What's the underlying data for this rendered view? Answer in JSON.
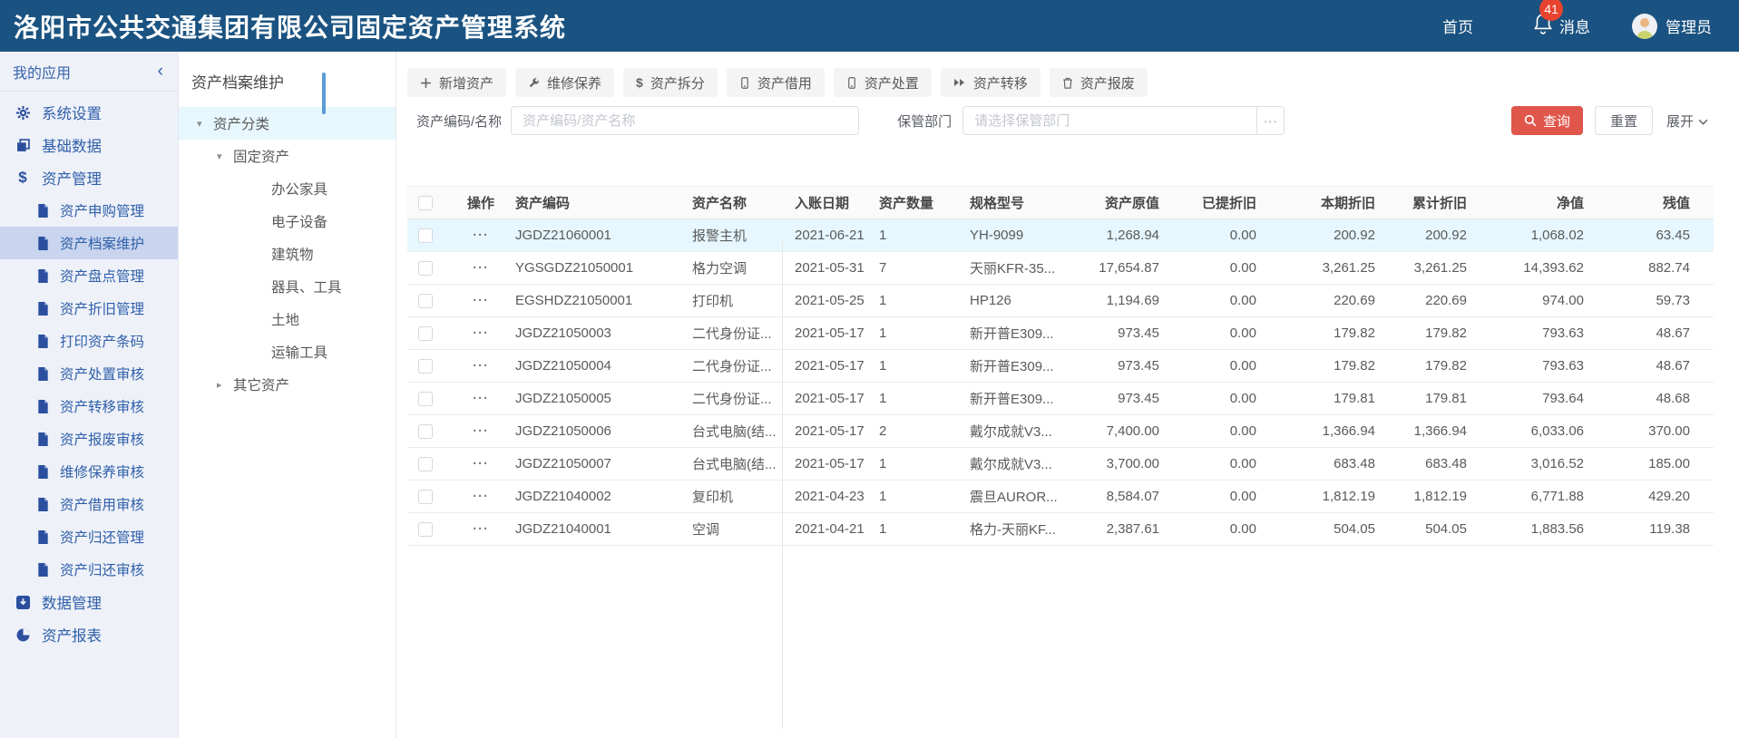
{
  "header": {
    "title": "洛阳市公共交通集团有限公司固定资产管理系统",
    "nav_home": "首页",
    "nav_messages": "消息",
    "message_count": "41",
    "user_name": "管理员"
  },
  "sidebar": {
    "title": "我的应用",
    "collapse": "‹",
    "items": [
      {
        "label": "系统设置",
        "icon": "gear",
        "level": 0
      },
      {
        "label": "基础数据",
        "icon": "copy",
        "level": 0
      },
      {
        "label": "资产管理",
        "icon": "dollar",
        "level": 0
      },
      {
        "label": "资产申购管理",
        "icon": "file",
        "level": 1
      },
      {
        "label": "资产档案维护",
        "icon": "file",
        "level": 1,
        "active": true
      },
      {
        "label": "资产盘点管理",
        "icon": "file",
        "level": 1
      },
      {
        "label": "资产折旧管理",
        "icon": "file",
        "level": 1
      },
      {
        "label": "打印资产条码",
        "icon": "file",
        "level": 1
      },
      {
        "label": "资产处置审核",
        "icon": "file",
        "level": 1
      },
      {
        "label": "资产转移审核",
        "icon": "file",
        "level": 1
      },
      {
        "label": "资产报废审核",
        "icon": "file",
        "level": 1
      },
      {
        "label": "维修保养审核",
        "icon": "file",
        "level": 1
      },
      {
        "label": "资产借用审核",
        "icon": "file",
        "level": 1
      },
      {
        "label": "资产归还管理",
        "icon": "file",
        "level": 1
      },
      {
        "label": "资产归还审核",
        "icon": "file",
        "level": 1
      },
      {
        "label": "数据管理",
        "icon": "data",
        "level": 0
      },
      {
        "label": "资产报表",
        "icon": "chart",
        "level": 0
      }
    ]
  },
  "tree": {
    "title": "资产档案维护",
    "nodes": [
      {
        "label": "资产分类",
        "level": 0,
        "caret": "down",
        "selected": true
      },
      {
        "label": "固定资产",
        "level": 1,
        "caret": "down"
      },
      {
        "label": "办公家具",
        "level": 2,
        "caret": "none"
      },
      {
        "label": "电子设备",
        "level": 2,
        "caret": "none"
      },
      {
        "label": "建筑物",
        "level": 2,
        "caret": "none"
      },
      {
        "label": "器具、工具",
        "level": 2,
        "caret": "none"
      },
      {
        "label": "土地",
        "level": 2,
        "caret": "none"
      },
      {
        "label": "运输工具",
        "level": 2,
        "caret": "none"
      },
      {
        "label": "其它资产",
        "level": 1,
        "caret": "right"
      }
    ]
  },
  "toolbar": {
    "buttons": [
      {
        "label": "新增资产",
        "icon": "plus"
      },
      {
        "label": "维修保养",
        "icon": "wrench"
      },
      {
        "label": "资产拆分",
        "icon": "split"
      },
      {
        "label": "资产借用",
        "icon": "device"
      },
      {
        "label": "资产处置",
        "icon": "device"
      },
      {
        "label": "资产转移",
        "icon": "forward"
      },
      {
        "label": "资产报废",
        "icon": "trash"
      }
    ]
  },
  "filters": {
    "code_label": "资产编码/名称",
    "code_placeholder": "资产编码/资产名称",
    "dept_label": "保管部门",
    "dept_placeholder": "请选择保管部门",
    "more_label": "···",
    "search_label": "查询",
    "reset_label": "重置",
    "expand_label": "展开"
  },
  "table": {
    "more_icon": "···",
    "columns": [
      {
        "key": "op",
        "label": "操作",
        "align": "center"
      },
      {
        "key": "code",
        "label": "资产编码",
        "align": "left"
      },
      {
        "key": "name",
        "label": "资产名称",
        "align": "left"
      },
      {
        "key": "date",
        "label": "入账日期",
        "align": "left"
      },
      {
        "key": "qty",
        "label": "资产数量",
        "align": "left"
      },
      {
        "key": "model",
        "label": "规格型号",
        "align": "left"
      },
      {
        "key": "orig",
        "label": "资产原值",
        "align": "right"
      },
      {
        "key": "taken",
        "label": "已提折旧",
        "align": "right"
      },
      {
        "key": "cur",
        "label": "本期折旧",
        "align": "right"
      },
      {
        "key": "acc",
        "label": "累计折旧",
        "align": "right"
      },
      {
        "key": "net",
        "label": "净值",
        "align": "right"
      },
      {
        "key": "resid",
        "label": "残值",
        "align": "right"
      }
    ],
    "rows": [
      {
        "code": "JGDZ21060001",
        "name": "报警主机",
        "date": "2021-06-21",
        "qty": "1",
        "model": "YH-9099",
        "orig": "1,268.94",
        "taken": "0.00",
        "cur": "200.92",
        "acc": "200.92",
        "net": "1,068.02",
        "resid": "63.45",
        "highlight": true
      },
      {
        "code": "YGSGDZ21050001",
        "name": "格力空调",
        "date": "2021-05-31",
        "qty": "7",
        "model": "天丽KFR-35...",
        "orig": "17,654.87",
        "taken": "0.00",
        "cur": "3,261.25",
        "acc": "3,261.25",
        "net": "14,393.62",
        "resid": "882.74"
      },
      {
        "code": "EGSHDZ21050001",
        "name": "打印机",
        "date": "2021-05-25",
        "qty": "1",
        "model": "HP126",
        "orig": "1,194.69",
        "taken": "0.00",
        "cur": "220.69",
        "acc": "220.69",
        "net": "974.00",
        "resid": "59.73"
      },
      {
        "code": "JGDZ21050003",
        "name": "二代身份证...",
        "date": "2021-05-17",
        "qty": "1",
        "model": "新开普E309...",
        "orig": "973.45",
        "taken": "0.00",
        "cur": "179.82",
        "acc": "179.82",
        "net": "793.63",
        "resid": "48.67"
      },
      {
        "code": "JGDZ21050004",
        "name": "二代身份证...",
        "date": "2021-05-17",
        "qty": "1",
        "model": "新开普E309...",
        "orig": "973.45",
        "taken": "0.00",
        "cur": "179.82",
        "acc": "179.82",
        "net": "793.63",
        "resid": "48.67"
      },
      {
        "code": "JGDZ21050005",
        "name": "二代身份证...",
        "date": "2021-05-17",
        "qty": "1",
        "model": "新开普E309...",
        "orig": "973.45",
        "taken": "0.00",
        "cur": "179.81",
        "acc": "179.81",
        "net": "793.64",
        "resid": "48.68"
      },
      {
        "code": "JGDZ21050006",
        "name": "台式电脑(结...",
        "date": "2021-05-17",
        "qty": "2",
        "model": "戴尔成就V3...",
        "orig": "7,400.00",
        "taken": "0.00",
        "cur": "1,366.94",
        "acc": "1,366.94",
        "net": "6,033.06",
        "resid": "370.00"
      },
      {
        "code": "JGDZ21050007",
        "name": "台式电脑(结...",
        "date": "2021-05-17",
        "qty": "1",
        "model": "戴尔成就V3...",
        "orig": "3,700.00",
        "taken": "0.00",
        "cur": "683.48",
        "acc": "683.48",
        "net": "3,016.52",
        "resid": "185.00"
      },
      {
        "code": "JGDZ21040002",
        "name": "复印机",
        "date": "2021-04-23",
        "qty": "1",
        "model": "震旦AUROR...",
        "orig": "8,584.07",
        "taken": "0.00",
        "cur": "1,812.19",
        "acc": "1,812.19",
        "net": "6,771.88",
        "resid": "429.20"
      },
      {
        "code": "JGDZ21040001",
        "name": "空调",
        "date": "2021-04-21",
        "qty": "1",
        "model": "格力-天丽KF...",
        "orig": "2,387.61",
        "taken": "0.00",
        "cur": "504.05",
        "acc": "504.05",
        "net": "1,883.56",
        "resid": "119.38"
      }
    ]
  },
  "colors": {
    "header_bg": "#1a5381",
    "badge_red": "#e8432e",
    "accent_red": "#e0564b",
    "row_highlight": "#e6f7ff",
    "sidebar_selected": "#c9d5ee",
    "tree_selected": "#e7f7fe"
  }
}
